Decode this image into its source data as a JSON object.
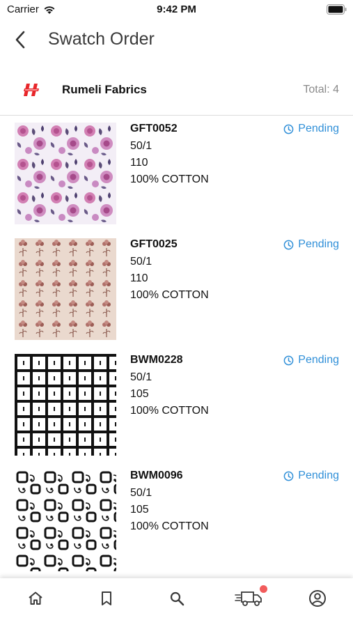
{
  "status_bar": {
    "carrier": "Carrier",
    "time": "9:42 PM"
  },
  "header": {
    "title": "Swatch Order"
  },
  "supplier": {
    "name": "Rumeli Fabrics",
    "total": "Total: 4",
    "logo_color": "#e8262a"
  },
  "orders": [
    {
      "code": "GFT0052",
      "count": "50/1",
      "width": "110",
      "composition": "100% COTTON",
      "status": "Pending",
      "pattern": "pink-floral"
    },
    {
      "code": "GFT0025",
      "count": "50/1",
      "width": "110",
      "composition": "100% COTTON",
      "status": "Pending",
      "pattern": "beige-tulip"
    },
    {
      "code": "BWM0228",
      "count": "50/1",
      "width": "105",
      "composition": "100% COTTON",
      "status": "Pending",
      "pattern": "black-white-grid"
    },
    {
      "code": "BWM0096",
      "count": "50/1",
      "width": "105",
      "composition": "100% COTTON",
      "status": "Pending",
      "pattern": "black-white-swirls"
    }
  ],
  "tabs": [
    {
      "name": "home-icon"
    },
    {
      "name": "bookmark-icon"
    },
    {
      "name": "search-icon"
    },
    {
      "name": "delivery-truck-icon",
      "has_badge": true
    },
    {
      "name": "account-icon"
    }
  ],
  "colors": {
    "accent": "#2f8fd8",
    "badge": "#f25c5c",
    "icon": "#3a3a3a"
  }
}
